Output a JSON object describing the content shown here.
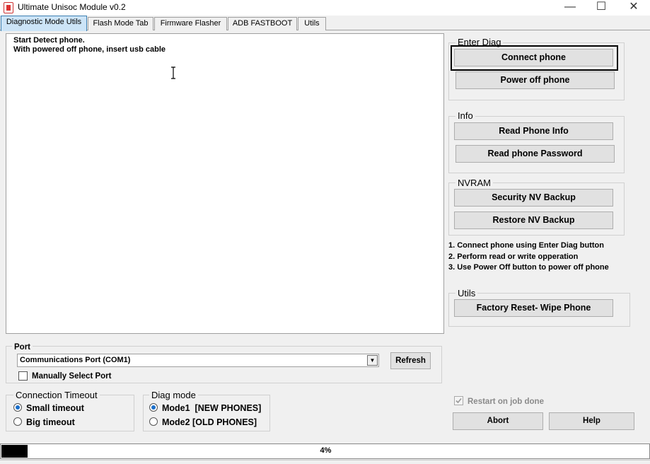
{
  "window": {
    "title": "Ultimate Unisoc Module v0.2",
    "minimize": "—",
    "maximize": "☐",
    "close": "✕"
  },
  "tabs": [
    {
      "label": "Diagnostic  Mode Utils"
    },
    {
      "label": "Flash Mode Tab"
    },
    {
      "label": "Firmware Flasher"
    },
    {
      "label": "ADB FASTBOOT"
    },
    {
      "label": "Utils"
    }
  ],
  "log": {
    "lines": [
      "Start Detect phone.",
      "With powered off phone, insert usb cable"
    ]
  },
  "enter_diag": {
    "title": "Enter Diag",
    "connect": "Connect phone",
    "power_off": "Power off phone"
  },
  "info": {
    "title": "Info",
    "read_info": "Read Phone Info",
    "read_password": "Read phone Password"
  },
  "nvram": {
    "title": "NVRAM",
    "backup": "Security NV Backup",
    "restore": "Restore NV Backup"
  },
  "notes": [
    "1. Connect phone using Enter Diag button",
    "2. Perform read or write opperation",
    "3. Use Power Off button to power off phone"
  ],
  "utils": {
    "title": "Utils",
    "factory_reset": "Factory Reset- Wipe Phone"
  },
  "port": {
    "title": "Port",
    "selected": "Communications Port (COM1)",
    "refresh": "Refresh",
    "manual": "Manually Select Port"
  },
  "timeout": {
    "title": "Connection Timeout",
    "small": "Small timeout",
    "big": "Big timeout"
  },
  "diag_mode": {
    "title": "Diag mode",
    "mode1": "Mode1  [NEW PHONES]",
    "mode2": "Mode2 [OLD PHONES]"
  },
  "options": {
    "restart": "Restart on job done",
    "abort": "Abort",
    "help": "Help"
  },
  "progress": {
    "percent": 4,
    "label": "4%"
  },
  "colors": {
    "accent": "#cce4f7",
    "radio_dot": "#1a6ec9"
  }
}
